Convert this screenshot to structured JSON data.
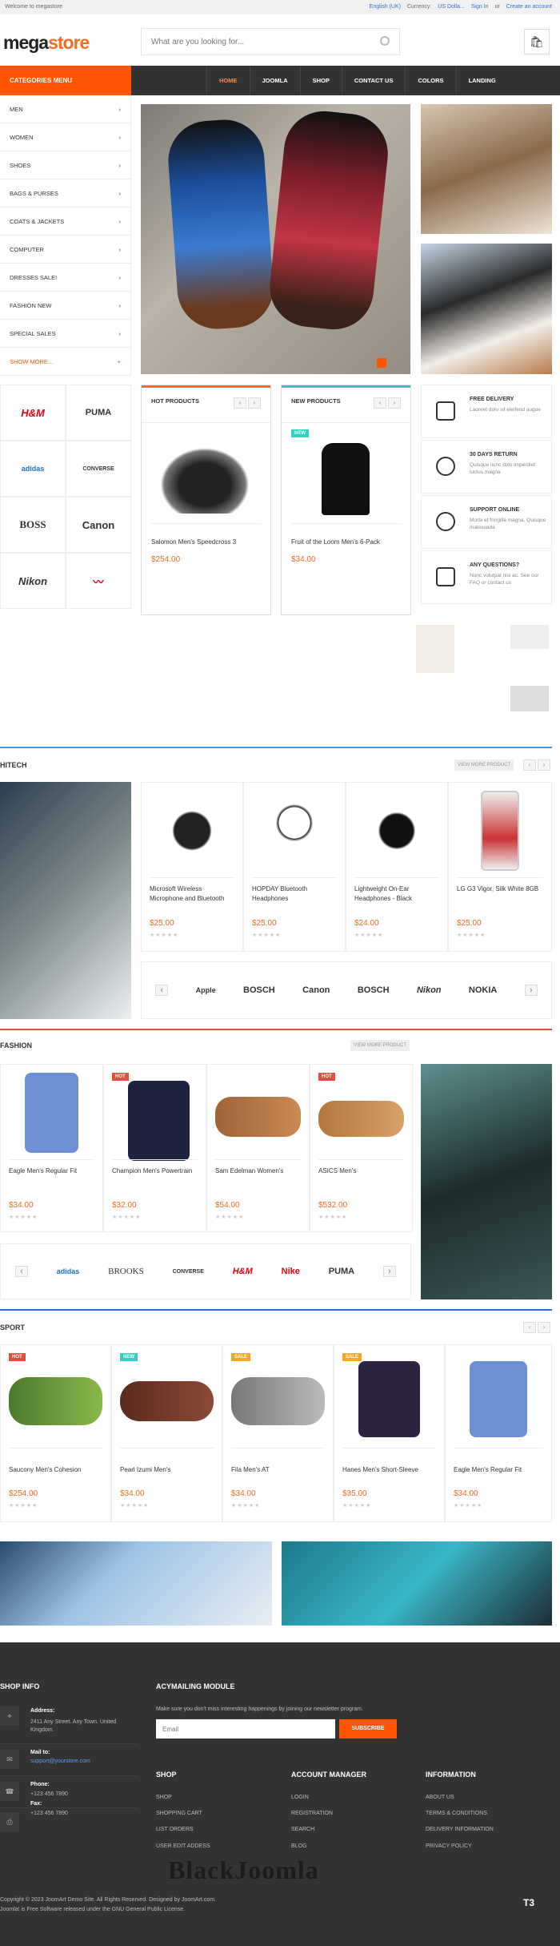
{
  "topbar": {
    "welcome": "Welcome to megastore",
    "language": "English (UK)",
    "currency_label": "Currency:",
    "currency": "US Dolla...",
    "signin": "Sign In",
    "or": "or",
    "create": "Create an account"
  },
  "logo": {
    "main": "mega",
    "accent": "store"
  },
  "search": {
    "placeholder": "What are you looking for..."
  },
  "nav": {
    "categories": "CATEGORIES MENU",
    "items": [
      "HOME",
      "JOOMLA",
      "SHOP",
      "CONTACT US",
      "COLORS",
      "LANDING"
    ]
  },
  "categories": [
    "MEN",
    "WOMEN",
    "SHOES",
    "BAGS & PURSES",
    "COATS & JACKETS",
    "COMPUTER",
    "DRESSES SALE!",
    "FASHION NEW",
    "SPECIAL SALES",
    "SHOW MORE..."
  ],
  "hero": {
    "page": "1"
  },
  "brands": [
    "H&M",
    "PUMA",
    "adidas",
    "CONVERSE",
    "BOSS",
    "Canon",
    "Nikon",
    "Nike"
  ],
  "hot": {
    "title": "HOT PRODUCTS",
    "name": "Salomon Men's Speedcross 3",
    "price": "$254.00"
  },
  "new": {
    "title": "NEW PRODUCTS",
    "badge": "NEW",
    "name": "Fruit of the Loom Men's 6-Pack",
    "price": "$34.00"
  },
  "features": [
    {
      "t": "FREE DELIVERY",
      "d": "Laoreet dolo sit eleifend augue"
    },
    {
      "t": "30 DAYS RETURN",
      "d": "Quisque iiunc dolo imperdiet luctus magna"
    },
    {
      "t": "SUPPORT ONLINE",
      "d": "Morbi et fringilla magna. Quisque malesuada"
    },
    {
      "t": "ANY QUESTIONS?",
      "d": "Nunc volutpat nisl ac. See our FAQ or contact us"
    }
  ],
  "hitech": {
    "title": "HITECH",
    "view": "VIEW MORE PRODUCT",
    "products": [
      {
        "name": "Microsoft Wireless Microphone and Bluetooth",
        "price": "$25.00"
      },
      {
        "name": "HOPDAY Bluetooth Headphones",
        "price": "$25.00"
      },
      {
        "name": "Lightweight On-Ear Headphones - Black",
        "price": "$24.00"
      },
      {
        "name": "LG G3 Vigor, Silk White 8GB",
        "price": "$25.00"
      }
    ],
    "brands": [
      "Apple",
      "BOSCH",
      "Canon",
      "BOSCH",
      "Nikon",
      "NOKIA"
    ]
  },
  "fashion": {
    "title": "FASHION",
    "view": "VIEW MORE PRODUCT",
    "products": [
      {
        "name": "Eagle Men's Regular Fit",
        "price": "$34.00",
        "badge": ""
      },
      {
        "name": "Champion Men's Powertrain",
        "price": "$32.00",
        "badge": "HOT"
      },
      {
        "name": "Sam Edelman Women's",
        "price": "$54.00",
        "badge": ""
      },
      {
        "name": "ASICS Men's",
        "price": "$532.00",
        "badge": "HOT"
      }
    ],
    "brands": [
      "adidas",
      "BROOKS",
      "CONVERSE",
      "H&M",
      "Nike",
      "PUMA"
    ]
  },
  "sport": {
    "title": "SPORT",
    "products": [
      {
        "name": "Saucony Men's Cohesion",
        "price": "$254.00",
        "badge": "HOT"
      },
      {
        "name": "Pearl Izumi Men's",
        "price": "$34.00",
        "badge": "NEW"
      },
      {
        "name": "Fila Men's AT",
        "price": "$34.00",
        "badge": "SALE"
      },
      {
        "name": "Hanes Men's Short-Sleeve",
        "price": "$35.00",
        "badge": "SALE"
      },
      {
        "name": "Eagle Men's Regular Fit",
        "price": "$34.00",
        "badge": ""
      }
    ]
  },
  "stars": "★★★★★",
  "footer": {
    "shopinfo": "SHOP INFO",
    "address_label": "Address:",
    "address": "2411 Any Street. Any Town. United Kingdom.",
    "mail_label": "Mail to:",
    "mail": "support@yourstore.com",
    "phone_label": "Phone:",
    "phone": "+123 456 7890",
    "fax_label": "Fax:",
    "fax": "+123 456 7890",
    "acy": "ACYMAILING MODULE",
    "acy_text": "Make sure you don't miss interesting happenings by joining our newsletter program.",
    "email_placeholder": "Email",
    "subscribe": "SUBSCRIBE",
    "shop": {
      "title": "SHOP",
      "links": [
        "SHOP",
        "SHOPPING CART",
        "LIST ORDERS",
        "USER EDIT ADDESS"
      ]
    },
    "account": {
      "title": "ACCOUNT MANAGER",
      "links": [
        "LOGIN",
        "REGISTRATION",
        "SEARCH",
        "BLOG"
      ]
    },
    "info": {
      "title": "INFORMATION",
      "links": [
        "ABOUT US",
        "TERMS & CONDITIONS",
        "DELIVERY INFORMATION",
        "PRIVACY POLICY"
      ]
    },
    "watermark": "BlackJoomla",
    "copyright": "Copyright © 2023 JoomArt Demo Site. All Rights Reserved. Designed by JoomArt.com.",
    "license": "Joomla! is Free Software released under the GNU General Public License.",
    "t3": "T3"
  }
}
